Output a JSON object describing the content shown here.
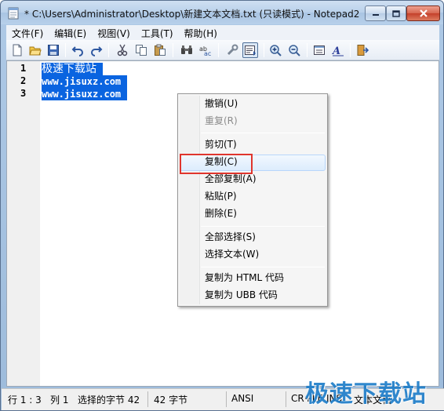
{
  "window": {
    "title": "* C:\\Users\\Administrator\\Desktop\\新建文本文档.txt (只读模式) - Notepad2",
    "controls": {
      "minimize": "minimize-icon",
      "maximize": "maximize-icon",
      "close": "close-icon"
    }
  },
  "menubar": {
    "items": [
      {
        "label": "文件(F)"
      },
      {
        "label": "编辑(E)"
      },
      {
        "label": "视图(V)"
      },
      {
        "label": "工具(T)"
      },
      {
        "label": "帮助(H)"
      }
    ]
  },
  "toolbar": {
    "icons": [
      "new-file-icon",
      "open-folder-icon",
      "save-icon",
      "undo-icon",
      "redo-icon",
      "cut-icon",
      "copy-icon",
      "paste-icon",
      "find-icon",
      "replace-icon",
      "wrench-icon",
      "view-mode-icon",
      "zoom-in-icon",
      "zoom-out-icon",
      "properties-icon",
      "font-icon",
      "exit-icon"
    ],
    "pressed": "view-mode-icon"
  },
  "editor": {
    "lines": [
      {
        "number": "1",
        "text": "极速下载站"
      },
      {
        "number": "2",
        "text": "www.jisuxz.com"
      },
      {
        "number": "3",
        "text": "www.jisuxz.com"
      }
    ],
    "selection_color": "#0a64e0"
  },
  "context_menu": {
    "items": [
      {
        "label": "撤销(U)",
        "enabled": true
      },
      {
        "label": "重复(R)",
        "enabled": false
      },
      {
        "label": "剪切(T)",
        "enabled": true
      },
      {
        "label": "复制(C)",
        "enabled": true,
        "hovered": true
      },
      {
        "label": "全部复制(A)",
        "enabled": true
      },
      {
        "label": "粘贴(P)",
        "enabled": true
      },
      {
        "label": "删除(E)",
        "enabled": true
      },
      {
        "label": "全部选择(S)",
        "enabled": true
      },
      {
        "label": "选择文本(W)",
        "enabled": true
      },
      {
        "label": "复制为 HTML 代码",
        "enabled": true
      },
      {
        "label": "复制为 UBB 代码",
        "enabled": true
      }
    ],
    "highlight_color": "#e0352d"
  },
  "statusbar": {
    "position": "行 1 : 3",
    "column": "列 1",
    "selected_bytes": "选择的字节 42",
    "total_bytes": "42 字节",
    "encoding": "ANSI",
    "line_ending": "CR+LF",
    "insert_mode": "INS",
    "doc_type": "文本文档"
  },
  "watermark": "极速下载站"
}
